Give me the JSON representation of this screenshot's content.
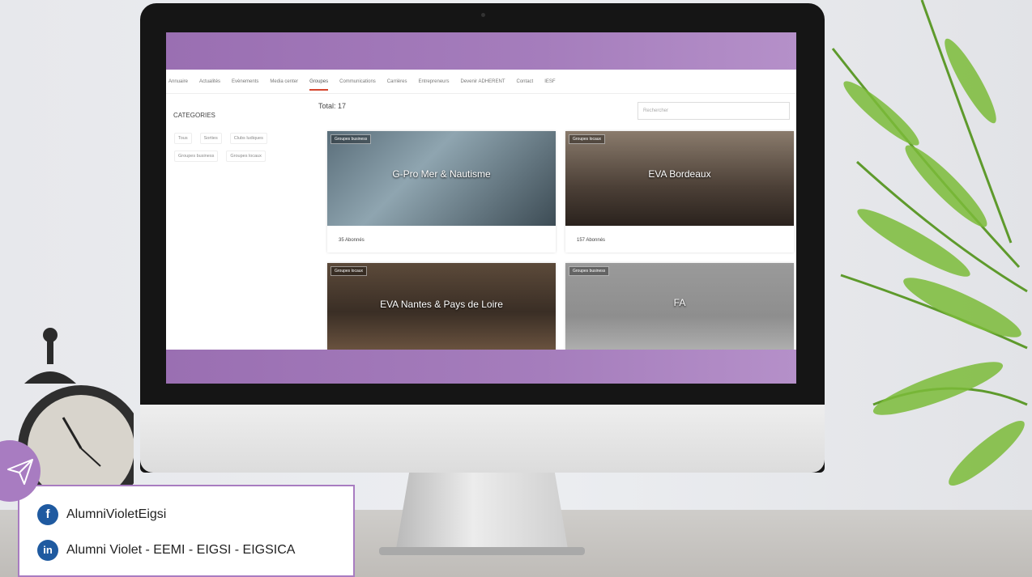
{
  "nav": {
    "items": [
      "Annuaire",
      "Actualités",
      "Evènements",
      "Media center",
      "Groupes",
      "Communications",
      "Carrières",
      "Entrepreneurs",
      "Devenir ADHERENT",
      "Contact",
      "IESF"
    ],
    "active_index": 4
  },
  "sidebar": {
    "title": "CATEGORIES",
    "chips": [
      "Tous",
      "Sorties",
      "Clubs ludiques",
      "Groupes business",
      "Groupes locaux"
    ]
  },
  "main": {
    "total_label": "Total: 17",
    "search_placeholder": "Rechercher"
  },
  "cards": [
    {
      "tag": "Groupes business",
      "title": "G-Pro Mer & Nautisme",
      "count": "35 Abonnés"
    },
    {
      "tag": "Groupes locaux",
      "title": "EVA Bordeaux",
      "count": "157 Abonnés"
    },
    {
      "tag": "Groupes locaux",
      "title": "EVA Nantes & Pays de Loire",
      "count": ""
    },
    {
      "tag": "Groupes business",
      "title": "FA",
      "count": ""
    }
  ],
  "social": {
    "facebook_label": "AlumniVioletEigsi",
    "linkedin_label": "Alumni Violet - EEMI - EIGSI - EIGSICA",
    "facebook_icon": "f",
    "linkedin_icon": "in",
    "accent": "#a87cc1",
    "icon_color": "#1f5aa0"
  },
  "colors": {
    "header_purple": "#a57dbc",
    "active_underline": "#d5452d"
  }
}
